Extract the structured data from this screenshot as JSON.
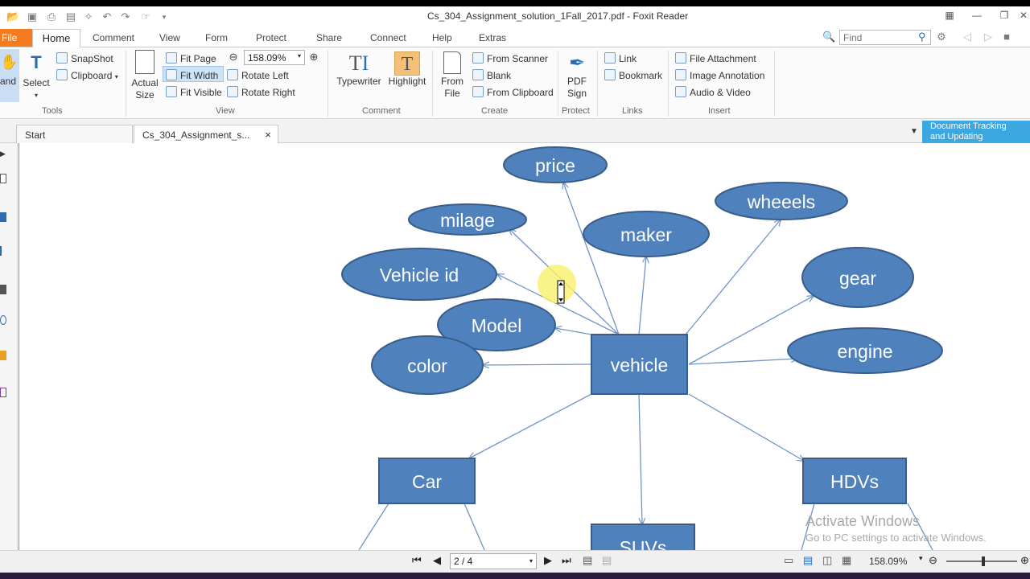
{
  "window": {
    "title": "Cs_304_Assignment_solution_1Fall_2017.pdf - Foxit Reader"
  },
  "ribbon_tabs": [
    "File",
    "Home",
    "Comment",
    "View",
    "Form",
    "Protect",
    "Share",
    "Connect",
    "Help",
    "Extras"
  ],
  "search": {
    "placeholder": "Find"
  },
  "tools_group": {
    "hand_label": "and",
    "select_label": "Select",
    "snapshot_label": "SnapShot",
    "clipboard_label": "Clipboard",
    "label": "Tools"
  },
  "view_group": {
    "actual_size_line1": "Actual",
    "actual_size_line2": "Size",
    "fit_page": "Fit Page",
    "fit_width": "Fit Width",
    "fit_visible": "Fit Visible",
    "zoom_value": "158.09%",
    "rotate_left": "Rotate Left",
    "rotate_right": "Rotate Right",
    "label": "View"
  },
  "comment_group": {
    "typewriter": "Typewriter",
    "highlight": "Highlight",
    "label": "Comment"
  },
  "create_group": {
    "from_file_line1": "From",
    "from_file_line2": "File",
    "from_scanner": "From Scanner",
    "blank": "Blank",
    "from_clipboard": "From Clipboard",
    "label": "Create"
  },
  "protect_group": {
    "pdf_sign_line1": "PDF",
    "pdf_sign_line2": "Sign",
    "label": "Protect"
  },
  "links_group": {
    "link": "Link",
    "bookmark": "Bookmark",
    "label": "Links"
  },
  "insert_group": {
    "file_attachment": "File Attachment",
    "image_annotation": "Image Annotation",
    "audio_video": "Audio & Video",
    "label": "Insert"
  },
  "doc_tabs": {
    "start": "Start",
    "document": "Cs_304_Assignment_s...",
    "close": "×"
  },
  "doc_tracking": {
    "line1": "Document Tracking",
    "line2": "and Updating"
  },
  "diagram": {
    "center": "vehicle",
    "attributes": [
      "price",
      "milage",
      "maker",
      "wheeels",
      "Vehicle id",
      "gear",
      "Model",
      "color",
      "engine"
    ],
    "subtypes": [
      "Car",
      "HDVs",
      "SUVs"
    ]
  },
  "status": {
    "page": "2 / 4",
    "zoom": "158.09%"
  },
  "watermark": {
    "line1": "Activate Windows",
    "line2": "Go to PC settings to activate Windows."
  },
  "colors": {
    "node_fill": "#4f81bd",
    "node_stroke": "#385d8a",
    "edge": "#6f94c7",
    "file_tab": "#f47b20",
    "tracking": "#3ca7e0"
  }
}
